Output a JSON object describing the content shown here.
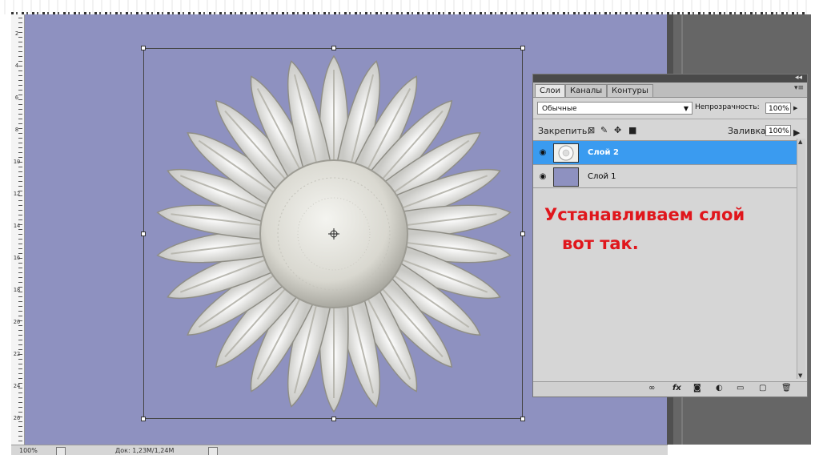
{
  "ruler": {
    "labels": [
      "2",
      "4",
      "6",
      "8",
      "10",
      "12",
      "14",
      "16",
      "18",
      "20",
      "22",
      "24",
      "26"
    ]
  },
  "status_bar": {
    "zoom": "100%",
    "doc_info": "Док: 1,23M/1,24M"
  },
  "layers_panel": {
    "tabs": [
      "Слои",
      "Каналы",
      "Контуры"
    ],
    "active_tab": "Слои",
    "blend_mode": "Обычные",
    "opacity_label": "Непрозрачность:",
    "opacity_value": "100%",
    "lock_label": "Закрепить:",
    "fill_label": "Заливка:",
    "fill_value": "100%",
    "layers": [
      {
        "name": "Слой 2",
        "selected": true,
        "visible": true,
        "thumb": "flower"
      },
      {
        "name": "Слой 1",
        "selected": false,
        "visible": true,
        "thumb": "solid",
        "thumb_color": "#8e91c0"
      }
    ],
    "bottom_icons": [
      "link-icon",
      "fx-icon",
      "mask-icon",
      "adjustment-icon",
      "group-icon",
      "new-layer-icon",
      "trash-icon"
    ]
  },
  "annotation": {
    "line1": "Устанавливаем слой",
    "line2": "вот так."
  },
  "colors": {
    "canvas": "#8e91c0",
    "selection": "#3a9bf0",
    "annotation": "#e0161c"
  }
}
